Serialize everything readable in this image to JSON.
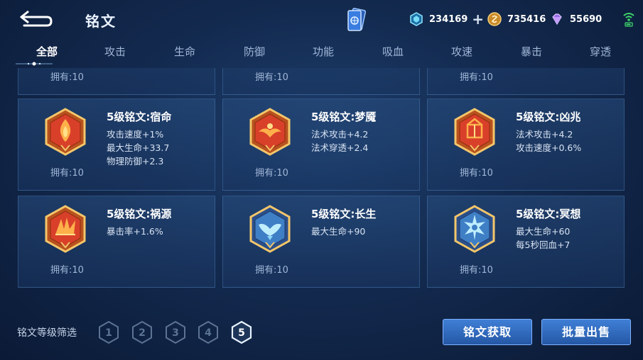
{
  "header": {
    "title": "铭文",
    "back_icon": "back-arrow-icon",
    "currencies": [
      {
        "icon": "diamond-icon",
        "value": "234169",
        "color": "#5fd6f5"
      },
      {
        "icon": "gold-coin-icon",
        "value": "735416",
        "color": "#d9a441"
      },
      {
        "icon": "crystal-icon",
        "value": "55690",
        "color": "#b88cf5"
      }
    ],
    "signal_icon": "wifi-signal-icon"
  },
  "tabs": [
    {
      "label": "全部",
      "active": true
    },
    {
      "label": "攻击"
    },
    {
      "label": "生命"
    },
    {
      "label": "防御"
    },
    {
      "label": "功能"
    },
    {
      "label": "吸血"
    },
    {
      "label": "攻速"
    },
    {
      "label": "暴击"
    },
    {
      "label": "穿透"
    }
  ],
  "top_partial_owned": [
    "拥有:10",
    "拥有:10",
    "拥有:10"
  ],
  "runes": [
    {
      "name": "5级铭文:宿命",
      "stats": [
        "攻击速度+1%",
        "最大生命+33.7",
        "物理防御+2.3"
      ],
      "owned": "拥有:10",
      "color": "red",
      "icon": "flame-rune-icon"
    },
    {
      "name": "5级铭文:梦魇",
      "stats": [
        "法术攻击+4.2",
        "法术穿透+2.4"
      ],
      "owned": "拥有:10",
      "color": "red",
      "icon": "nightmare-rune-icon"
    },
    {
      "name": "5级铭文:凶兆",
      "stats": [
        "法术攻击+4.2",
        "攻击速度+0.6%"
      ],
      "owned": "拥有:10",
      "color": "red",
      "icon": "omen-rune-icon"
    },
    {
      "name": "5级铭文:祸源",
      "stats": [
        "暴击率+1.6%"
      ],
      "owned": "拥有:10",
      "color": "red",
      "icon": "calamity-rune-icon"
    },
    {
      "name": "5级铭文:长生",
      "stats": [
        "最大生命+90"
      ],
      "owned": "拥有:10",
      "color": "blue",
      "icon": "longevity-rune-icon"
    },
    {
      "name": "5级铭文:冥想",
      "stats": [
        "最大生命+60",
        "每5秒回血+7"
      ],
      "owned": "拥有:10",
      "color": "blue",
      "icon": "meditation-rune-icon"
    }
  ],
  "footer": {
    "filter_label": "铭文等级筛选",
    "levels": [
      "1",
      "2",
      "3",
      "4",
      "5"
    ],
    "active_level": "5",
    "obtain_button": "铭文获取",
    "sell_button": "批量出售"
  }
}
